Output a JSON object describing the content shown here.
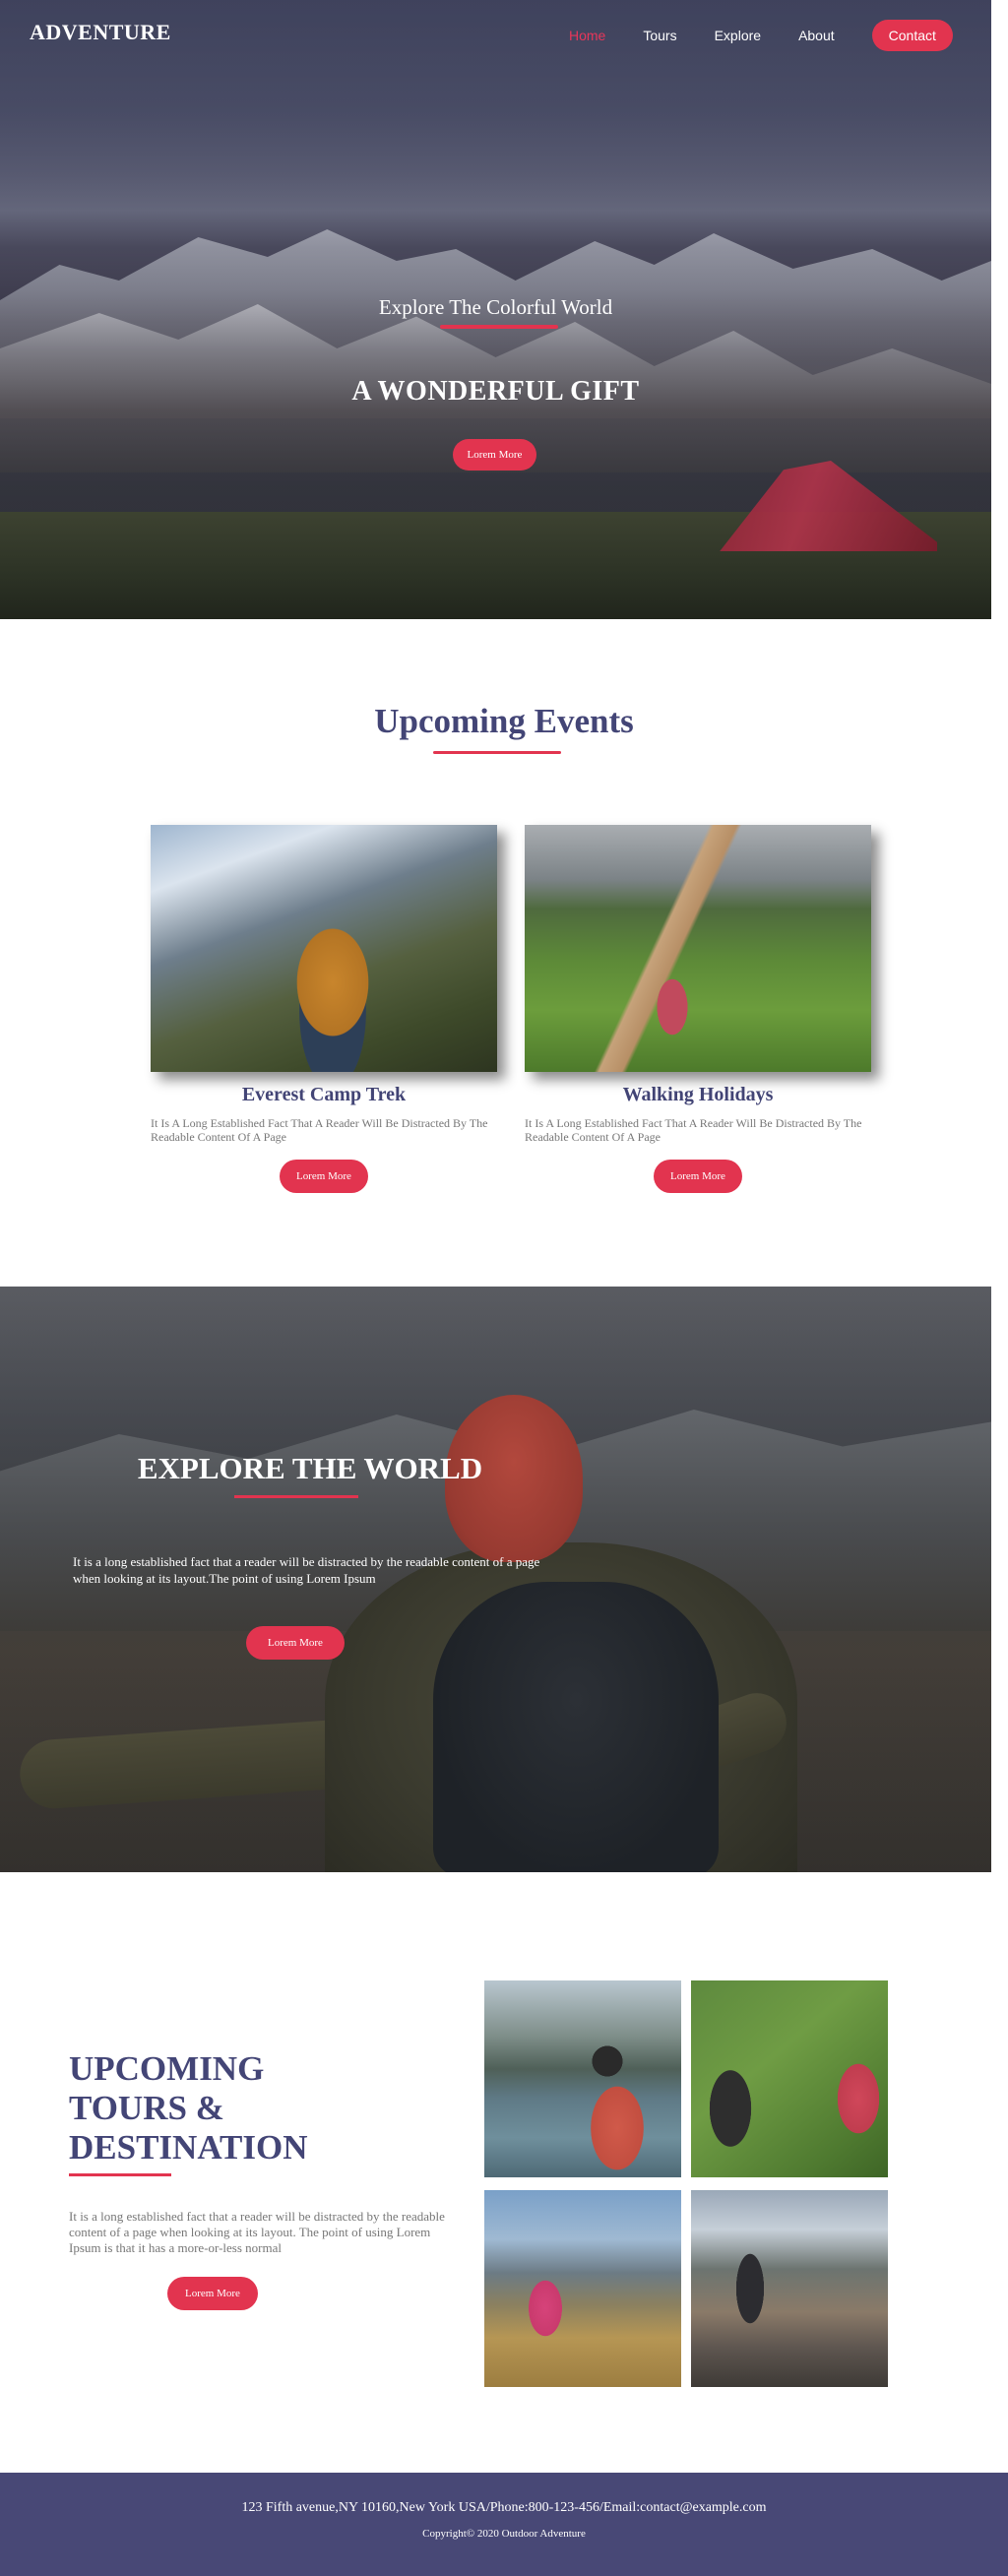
{
  "header": {
    "logo": "ADVENTURE",
    "nav": [
      {
        "label": "Home",
        "active": true
      },
      {
        "label": "Tours",
        "active": false
      },
      {
        "label": "Explore",
        "active": false
      },
      {
        "label": "About",
        "active": false
      },
      {
        "label": "Contact",
        "active": false
      }
    ]
  },
  "hero": {
    "subtitle": "Explore The Colorful World",
    "title": "A WONDERFUL GIFT",
    "button": "Lorem More"
  },
  "events": {
    "title": "Upcoming Events",
    "cards": [
      {
        "title": "Everest Camp Trek",
        "text": "It Is A Long Established Fact That A Reader Will Be Distracted By The Readable Content Of A Page",
        "button": "Lorem More"
      },
      {
        "title": "Walking Holidays",
        "text": "It Is A Long Established Fact That A Reader Will Be Distracted By The Readable Content Of A Page",
        "button": "Lorem More"
      }
    ]
  },
  "explore": {
    "title": "EXPLORE THE WORLD",
    "text": "It is a long established fact that a reader will be distracted by the readable content of a page when looking at its layout.The point of using Lorem Ipsum",
    "button": "Lorem More"
  },
  "tours": {
    "title_lines": [
      "UPCOMING",
      "TOURS &",
      "DESTINATION"
    ],
    "text": "It is a long established fact that a reader will be distracted by the readable content of a page when looking at its layout. The point of using Lorem Ipsum is that it has a more-or-less normal",
    "button": "Lorem More"
  },
  "footer": {
    "address": "123 Fifth avenue,NY 10160,New York USA/Phone:800-123-456/Email:contact@example.com",
    "copyright": "Copyright© 2020 Outdoor Adventure"
  },
  "colors": {
    "accent": "#e2344f",
    "heading": "#434576",
    "footer_bg": "#484876"
  }
}
